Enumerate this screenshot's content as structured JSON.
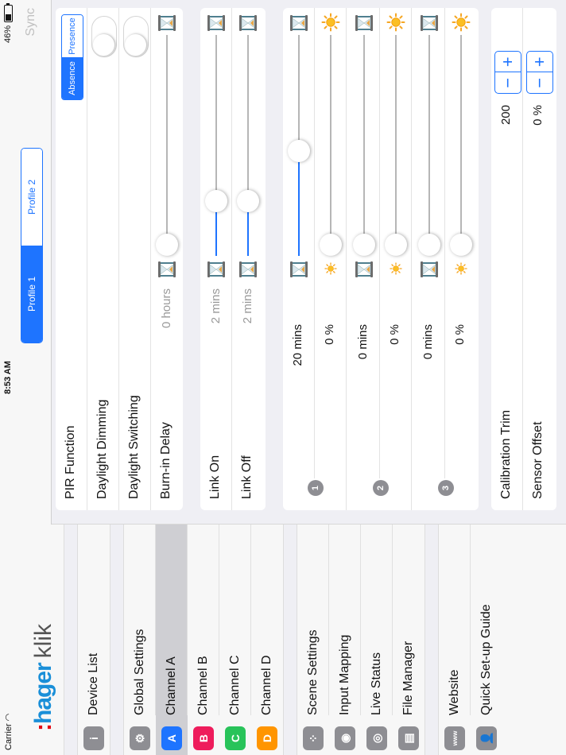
{
  "status": {
    "carrier": "Carrier",
    "time": "8:53 AM",
    "battery": "46%"
  },
  "app": {
    "brand": "hager",
    "product": "klik"
  },
  "sidebar": {
    "groups": [
      [
        {
          "label": "Device List",
          "icon": "i",
          "icon_name": "info-icon",
          "color": "gray",
          "active": false
        }
      ],
      [
        {
          "label": "Global Settings",
          "icon": "⚙",
          "icon_name": "gear-icon",
          "color": "gray",
          "active": false
        },
        {
          "label": "Channel A",
          "icon": "A",
          "icon_name": "channel-a-icon",
          "color": "blue",
          "active": true
        },
        {
          "label": "Channel B",
          "icon": "B",
          "icon_name": "channel-b-icon",
          "color": "pink",
          "active": false
        },
        {
          "label": "Channel C",
          "icon": "C",
          "icon_name": "channel-c-icon",
          "color": "green",
          "active": false
        },
        {
          "label": "Channel D",
          "icon": "D",
          "icon_name": "channel-d-icon",
          "color": "orange",
          "active": false
        }
      ],
      [
        {
          "label": "Scene Settings",
          "icon": "⁘",
          "icon_name": "scenes-icon",
          "color": "gray",
          "active": false
        },
        {
          "label": "Input Mapping",
          "icon": "◉",
          "icon_name": "input-mapping-icon",
          "color": "gray",
          "active": false
        },
        {
          "label": "Live Status",
          "icon": "◎",
          "icon_name": "live-status-icon",
          "color": "gray",
          "active": false
        },
        {
          "label": "File Manager",
          "icon": "▤",
          "icon_name": "file-manager-icon",
          "color": "gray",
          "active": false
        }
      ],
      [
        {
          "label": "Website",
          "icon": "www",
          "icon_name": "website-icon",
          "color": "gray",
          "active": false
        },
        {
          "label": "Quick Set-up Guide",
          "icon": "👤",
          "icon_name": "guide-icon",
          "color": "gray",
          "active": false
        }
      ]
    ]
  },
  "topbar": {
    "profiles": [
      {
        "label": "Profile 1",
        "selected": true
      },
      {
        "label": "Profile 2",
        "selected": false
      }
    ],
    "sync": "Sync"
  },
  "pir": {
    "function_label": "PIR Function",
    "options": [
      {
        "label": "Absence",
        "selected": true
      },
      {
        "label": "Presence",
        "selected": false
      }
    ],
    "daylight_dimming": {
      "label": "Daylight Dimming",
      "on": false
    },
    "daylight_switching": {
      "label": "Daylight Switching",
      "on": false
    },
    "burn_in": {
      "label": "Burn-in Delay",
      "value": "0 hours",
      "level": 0
    }
  },
  "link": {
    "on": {
      "label": "Link On",
      "value": "2 mins",
      "level": 0.22
    },
    "off": {
      "label": "Link Off",
      "value": "2 mins",
      "level": 0.22
    }
  },
  "scenes": [
    {
      "badge": "1",
      "time": "20 mins",
      "time_level": 0.47,
      "lux": "0 %",
      "lux_level": 0
    },
    {
      "badge": "2",
      "time": "0 mins",
      "time_level": 0,
      "lux": "0 %",
      "lux_level": 0
    },
    {
      "badge": "3",
      "time": "0 mins",
      "time_level": 0,
      "lux": "0 %",
      "lux_level": 0
    }
  ],
  "calibration": {
    "trim": {
      "label": "Calibration Trim",
      "value": "200"
    },
    "offset": {
      "label": "Sensor Offset",
      "value": "0 %"
    },
    "plus": "+",
    "minus": "−"
  },
  "colors": {
    "accent": "#1e74ff",
    "panel": "#ffffff",
    "background": "#efeff4"
  }
}
